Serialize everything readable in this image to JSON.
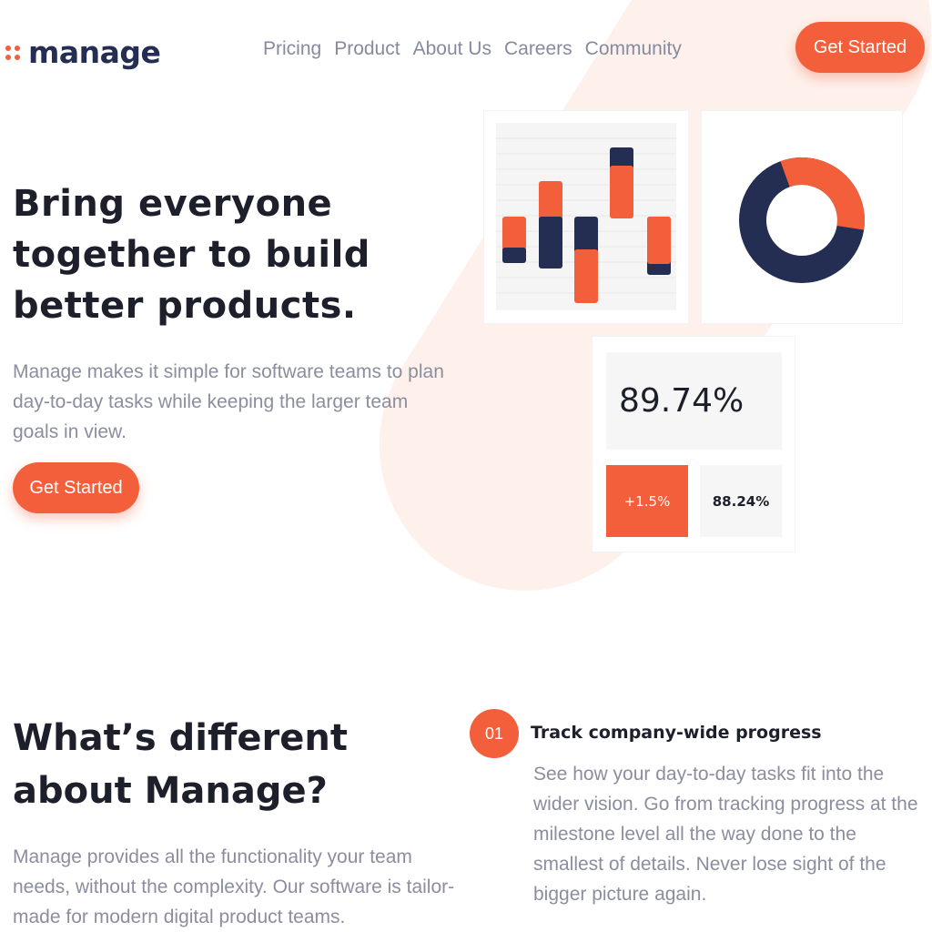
{
  "header": {
    "logo_text": "manage",
    "nav": [
      "Pricing",
      "Product",
      "About Us",
      "Careers",
      "Community"
    ],
    "cta_label": "Get Started"
  },
  "hero": {
    "title": "Bring everyone together to build better products.",
    "description": "Manage makes it simple for software teams to plan day-to-day tasks while keeping the larger team goals in view.",
    "cta_label": "Get Started"
  },
  "stats": {
    "main_value": "89.74%",
    "change": "+1.5%",
    "secondary_value": "88.24%"
  },
  "donut": {
    "orange_fraction": 0.33
  },
  "section": {
    "title": "What’s different about Manage?",
    "description": "Manage provides all the functionality your team needs, without the complexity. Our software is tailor-made for modern digital product teams."
  },
  "feature": {
    "number": "01",
    "title": "Track company-wide progress",
    "description": "See how your day-to-day tasks fit into the wider vision. Go from tracking progress at the milestone level all the way done to the smallest of details. Never lose sight of the bigger picture again."
  },
  "colors": {
    "accent": "#F25F3A",
    "navy": "#242D52",
    "muted": "#8A8E9E",
    "tint": "#FEF1EC"
  }
}
